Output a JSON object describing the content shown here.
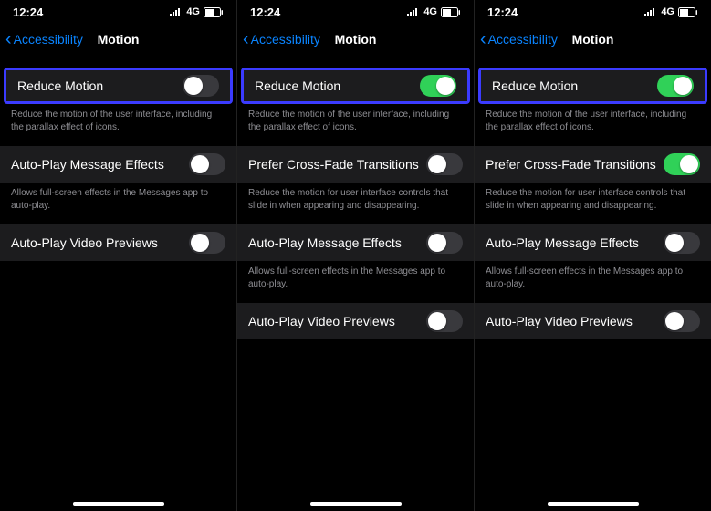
{
  "phones": [
    {
      "status": {
        "time": "12:24",
        "net": "4G"
      },
      "nav": {
        "back": "Accessibility",
        "title": "Motion"
      },
      "rows": [
        {
          "name": "reduce-motion-row",
          "highlight": true,
          "label": "Reduce Motion",
          "toggle": false,
          "footer": "Reduce the motion of the user interface, including the parallax effect of icons."
        },
        {
          "name": "autoplay-message-effects-row",
          "highlight": false,
          "label": "Auto-Play Message Effects",
          "toggle": false,
          "footer": "Allows full-screen effects in the Messages app to auto-play."
        },
        {
          "name": "autoplay-video-previews-row",
          "highlight": false,
          "label": "Auto-Play Video Previews",
          "toggle": false,
          "footer": null
        }
      ]
    },
    {
      "status": {
        "time": "12:24",
        "net": "4G"
      },
      "nav": {
        "back": "Accessibility",
        "title": "Motion"
      },
      "rows": [
        {
          "name": "reduce-motion-row",
          "highlight": true,
          "label": "Reduce Motion",
          "toggle": true,
          "footer": "Reduce the motion of the user interface, including the parallax effect of icons."
        },
        {
          "name": "prefer-cross-fade-row",
          "highlight": false,
          "label": "Prefer Cross-Fade Transitions",
          "toggle": false,
          "footer": "Reduce the motion for user interface controls that slide in when appearing and disappearing."
        },
        {
          "name": "autoplay-message-effects-row",
          "highlight": false,
          "label": "Auto-Play Message Effects",
          "toggle": false,
          "footer": "Allows full-screen effects in the Messages app to auto-play."
        },
        {
          "name": "autoplay-video-previews-row",
          "highlight": false,
          "label": "Auto-Play Video Previews",
          "toggle": false,
          "footer": null
        }
      ]
    },
    {
      "status": {
        "time": "12:24",
        "net": "4G"
      },
      "nav": {
        "back": "Accessibility",
        "title": "Motion"
      },
      "rows": [
        {
          "name": "reduce-motion-row",
          "highlight": true,
          "label": "Reduce Motion",
          "toggle": true,
          "footer": "Reduce the motion of the user interface, including the parallax effect of icons."
        },
        {
          "name": "prefer-cross-fade-row",
          "highlight": false,
          "label": "Prefer Cross-Fade Transitions",
          "toggle": true,
          "footer": "Reduce the motion for user interface controls that slide in when appearing and disappearing."
        },
        {
          "name": "autoplay-message-effects-row",
          "highlight": false,
          "label": "Auto-Play Message Effects",
          "toggle": false,
          "footer": "Allows full-screen effects in the Messages app to auto-play."
        },
        {
          "name": "autoplay-video-previews-row",
          "highlight": false,
          "label": "Auto-Play Video Previews",
          "toggle": false,
          "footer": null
        }
      ]
    }
  ]
}
